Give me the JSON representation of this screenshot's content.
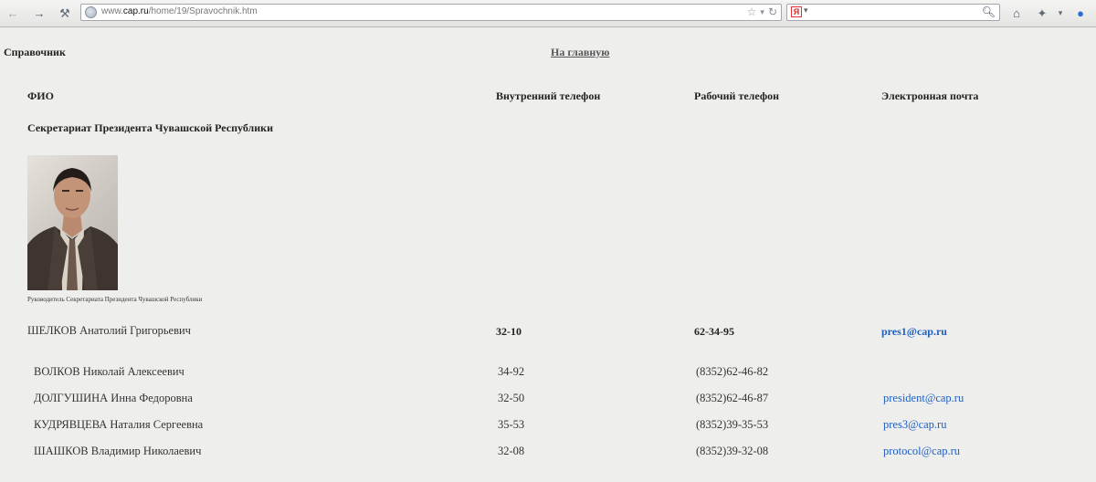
{
  "browser": {
    "url_prefix": "www.",
    "url_domain": "cap.ru",
    "url_path": "/home/19/Spravochnik.htm",
    "search_engine_icon": "Я"
  },
  "page": {
    "title": "Справочник",
    "home_link": "На главную",
    "headers": {
      "fio": "ФИО",
      "internal_phone": "Внутренний телефон",
      "work_phone": "Рабочий телефон",
      "email": "Электронная почта"
    },
    "section_title": "Секретариат Президента Чувашской Республики",
    "photo_caption": "Руководитель Секретариата Президента Чувашской Республики",
    "head": {
      "name": "ШЕЛКОВ Анатолий Григорьевич",
      "internal": "32-10",
      "work": "62-34-95",
      "email": "pres1@cap.ru"
    },
    "staff": [
      {
        "name": "ВОЛКОВ Николай Алексеевич",
        "internal": "34-92",
        "work": "(8352)62-46-82",
        "email": ""
      },
      {
        "name": "ДОЛГУШИНА Инна Федоровна",
        "internal": "32-50",
        "work": "(8352)62-46-87",
        "email": "president@cap.ru"
      },
      {
        "name": "КУДРЯВЦЕВА Наталия Сергеевна",
        "internal": "35-53",
        "work": "(8352)39-35-53",
        "email": "pres3@cap.ru"
      },
      {
        "name": "ШАШКОВ Владимир Николаевич",
        "internal": "32-08",
        "work": "(8352)39-32-08",
        "email": "protocol@cap.ru"
      }
    ]
  }
}
